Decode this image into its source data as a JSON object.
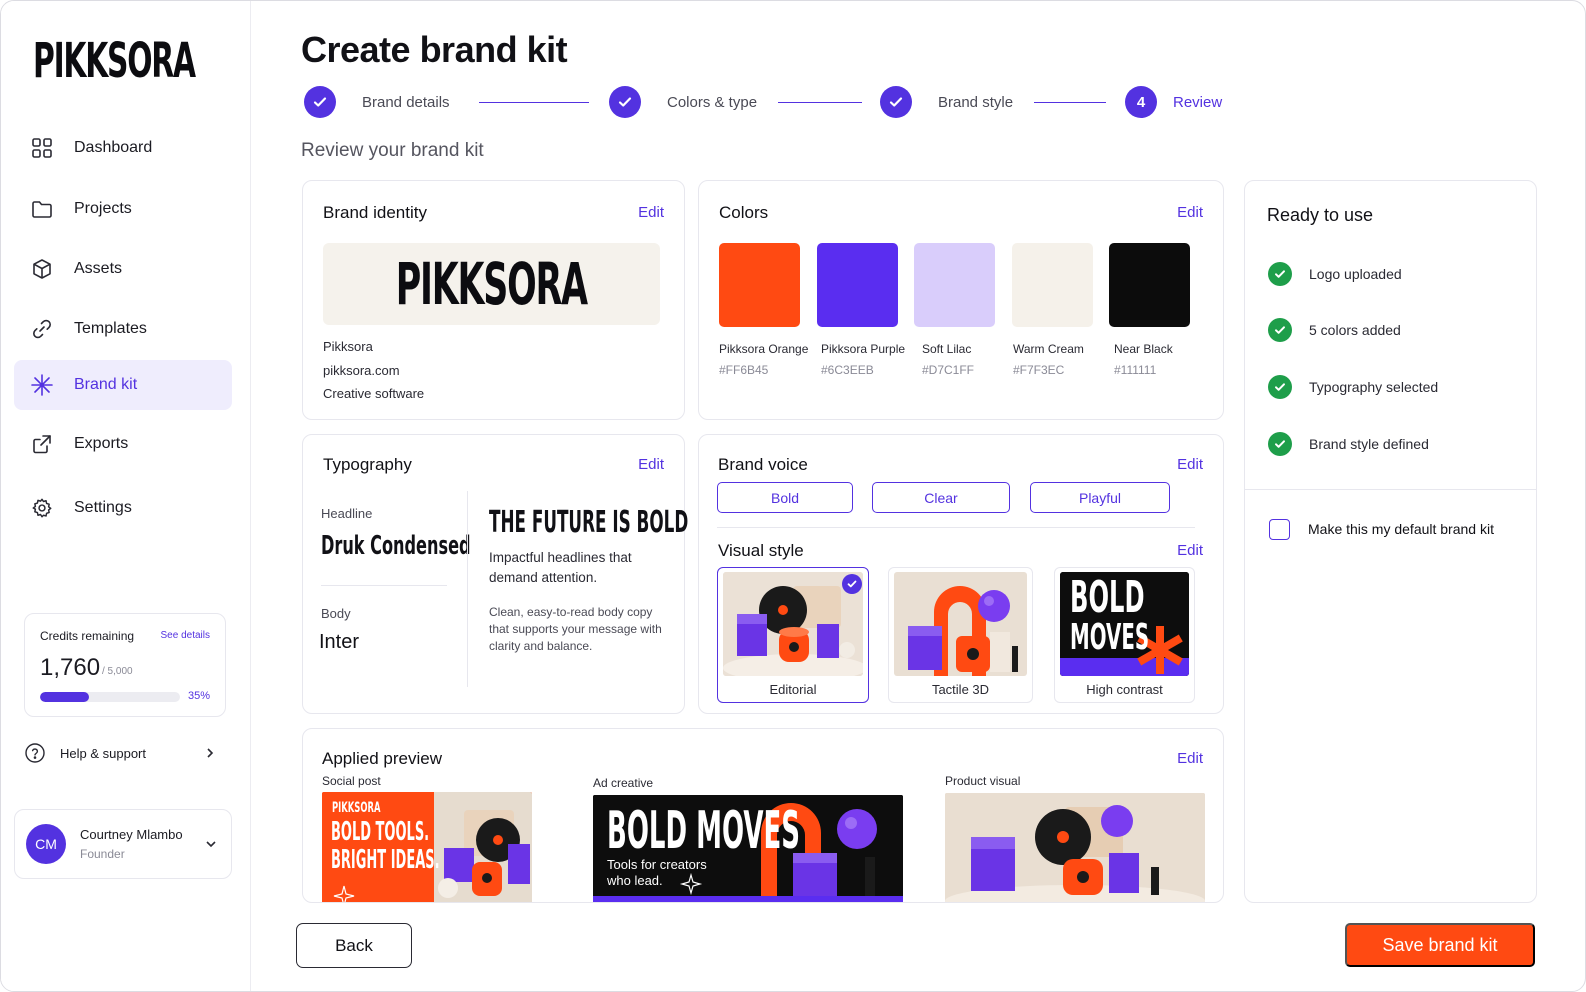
{
  "brand": {
    "logo_text": "PIKKSORA"
  },
  "sidebar": {
    "items": [
      {
        "label": "Dashboard",
        "icon": "grid-icon"
      },
      {
        "label": "Projects",
        "icon": "folder-icon"
      },
      {
        "label": "Assets",
        "icon": "cube-icon"
      },
      {
        "label": "Templates",
        "icon": "link-icon"
      },
      {
        "label": "Brand kit",
        "icon": "sparkle-icon",
        "active": true
      },
      {
        "label": "Exports",
        "icon": "export-icon"
      },
      {
        "label": "Settings",
        "icon": "gear-icon"
      }
    ],
    "credits": {
      "title": "Credits remaining",
      "link": "See details",
      "value": "1,760",
      "total": "/ 5,000",
      "percent_label": "35%",
      "percent": 35
    },
    "help": {
      "label": "Help & support"
    },
    "user": {
      "initials": "CM",
      "name": "Courtney Mlambo",
      "role": "Founder"
    }
  },
  "page": {
    "title": "Create brand kit",
    "subtitle": "Review your brand kit",
    "steps": [
      {
        "label": "Brand details",
        "status": "done"
      },
      {
        "label": "Colors & type",
        "status": "done"
      },
      {
        "label": "Brand style",
        "status": "done"
      },
      {
        "label": "Review",
        "status": "current",
        "number": "4"
      }
    ]
  },
  "identity": {
    "title": "Brand identity",
    "edit": "Edit",
    "logo_text": "PIKKSORA",
    "name": "Pikksora",
    "domain": "pikksora.com",
    "category": "Creative software"
  },
  "colors": {
    "title": "Colors",
    "edit": "Edit",
    "swatches": [
      {
        "name": "Pikksora Orange",
        "hex": "#FF6B45",
        "color": "#ff4a12"
      },
      {
        "name": "Pikksora Purple",
        "hex": "#6C3EEB",
        "color": "#5a2df0"
      },
      {
        "name": "Soft Lilac",
        "hex": "#D7C1FF",
        "color": "#d9cdfb"
      },
      {
        "name": "Warm Cream",
        "hex": "#F7F3EC",
        "color": "#f5f1ea"
      },
      {
        "name": "Near Black",
        "hex": "#111111",
        "color": "#0c0c0c"
      }
    ]
  },
  "typography": {
    "title": "Typography",
    "edit": "Edit",
    "headline_label": "Headline",
    "headline_font": "Druk Condensed",
    "body_label": "Body",
    "body_font": "Inter",
    "sample_headline": "THE FUTURE IS BOLD",
    "sample_sub": "Impactful headlines that demand attention.",
    "sample_body": "Clean, easy-to-read body copy that supports your message with clarity and balance."
  },
  "voice": {
    "title": "Brand voice",
    "edit": "Edit",
    "chips": [
      "Bold",
      "Clear",
      "Playful"
    ]
  },
  "visual_style": {
    "title": "Visual style",
    "edit": "Edit",
    "options": [
      {
        "label": "Editorial",
        "selected": true
      },
      {
        "label": "Tactile 3D"
      },
      {
        "label": "High contrast",
        "poster_line1": "BOLD",
        "poster_line2": "MOVES"
      }
    ]
  },
  "preview": {
    "title": "Applied preview",
    "edit": "Edit",
    "social": {
      "label": "Social post",
      "brand": "PIKKSORA",
      "line1": "BOLD TOOLS.",
      "line2": "BRIGHT IDEAS."
    },
    "ad": {
      "label": "Ad creative",
      "headline": "BOLD MOVES",
      "sub1": "Tools for creators",
      "sub2": "who lead."
    },
    "product": {
      "label": "Product visual"
    }
  },
  "ready": {
    "title": "Ready to use",
    "items": [
      "Logo uploaded",
      "5 colors added",
      "Typography selected",
      "Brand style defined"
    ],
    "default_label": "Make this my default brand kit"
  },
  "actions": {
    "back": "Back",
    "save": "Save brand kit"
  },
  "theme": {
    "accent": "#5332e0",
    "cta": "#ff4a12",
    "success": "#1e9e4a"
  }
}
